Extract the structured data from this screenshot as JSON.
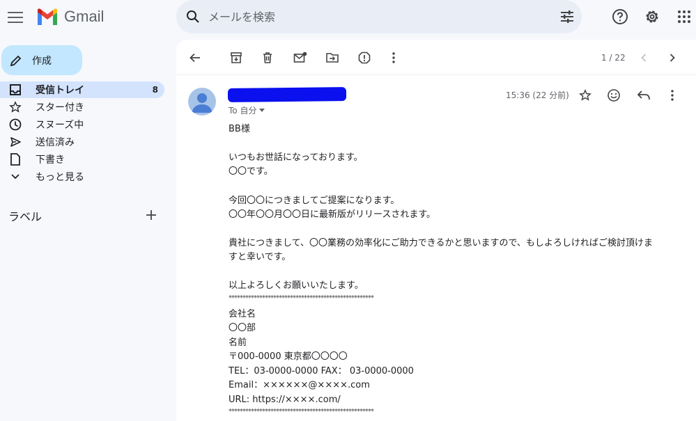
{
  "app": {
    "logo_text": "Gmail",
    "search_placeholder": "メールを検索"
  },
  "sidebar": {
    "compose_label": "作成",
    "items": [
      {
        "label": "受信トレイ",
        "count": "8"
      },
      {
        "label": "スター付き"
      },
      {
        "label": "スヌーズ中"
      },
      {
        "label": "送信済み"
      },
      {
        "label": "下書き"
      },
      {
        "label": "もっと見る"
      }
    ],
    "labels_heading": "ラベル"
  },
  "toolbar": {
    "pager": "1 / 22"
  },
  "message": {
    "to": "To 自分",
    "time": "15:36 (22 分前)",
    "lines": [
      "BB様",
      "いつもお世話になっております。",
      "〇〇です。",
      "今回〇〇につきましてご提案になります。",
      "〇〇年〇〇月〇〇日に最新版がリリースされます。",
      "貴社につきまして、〇〇業務の効率化にご助力できるかと思いますので、もしよろしければご検討頂けま",
      "すと幸いです。",
      "以上よろしくお願いいたします。",
      "****************************************************",
      "会社名",
      "〇〇部",
      "名前",
      "〒000-0000 東京都〇〇〇〇",
      "TEL：03-0000-0000 FAX： 03-0000-0000",
      "Email：××××××@××××.com",
      "URL: https://××××.com/",
      "****************************************************"
    ]
  },
  "colors": {
    "background": "#f6f8fc",
    "compose": "#c2e7ff",
    "active_nav": "#d3e3fd",
    "redaction": "#0a10ee"
  }
}
